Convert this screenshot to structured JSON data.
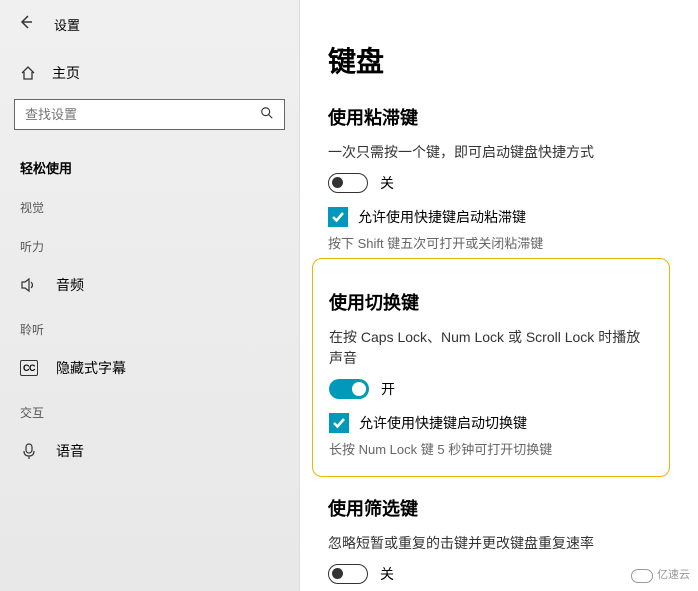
{
  "titlebar": {
    "title": "设置"
  },
  "sidebar": {
    "home": "主页",
    "search_placeholder": "查找设置",
    "current_category": "轻松使用",
    "groups": [
      {
        "label": "视觉",
        "items": []
      },
      {
        "label": "听力",
        "items": [
          {
            "icon": "speaker",
            "label": "音频"
          }
        ]
      },
      {
        "label": "聆听",
        "items": [
          {
            "icon": "cc",
            "label": "隐藏式字幕"
          }
        ]
      },
      {
        "label": "交互",
        "items": [
          {
            "icon": "mic",
            "label": "语音"
          }
        ]
      }
    ]
  },
  "main": {
    "heading": "键盘",
    "sections": [
      {
        "title": "使用粘滞键",
        "desc": "一次只需按一个键，即可启动键盘快捷方式",
        "toggle": {
          "state": "off",
          "label": "关"
        },
        "checkbox": {
          "checked": true,
          "label": "允许使用快捷键启动粘滞键"
        },
        "hint": "按下 Shift 键五次可打开或关闭粘滞键"
      },
      {
        "title": "使用切换键",
        "highlighted": true,
        "desc": "在按 Caps Lock、Num Lock 或 Scroll Lock 时播放声音",
        "toggle": {
          "state": "on",
          "label": "开"
        },
        "checkbox": {
          "checked": true,
          "label": "允许使用快捷键启动切换键"
        },
        "hint": "长按 Num Lock 键 5 秒钟可打开切换键"
      },
      {
        "title": "使用筛选键",
        "desc": "忽略短暂或重复的击键并更改键盘重复速率",
        "toggle": {
          "state": "off",
          "label": "关"
        }
      }
    ]
  },
  "watermark": "亿速云"
}
